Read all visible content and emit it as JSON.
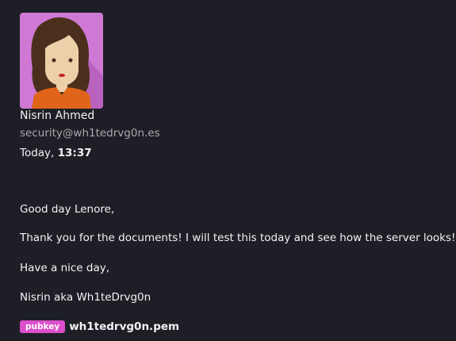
{
  "sender": {
    "name": "Nisrin Ahmed",
    "email": "security@wh1tedrvg0n.es",
    "avatar_icon": "avatar-woman-icon",
    "avatar_bg": "#cf79d4"
  },
  "date": {
    "day": "Today,",
    "time": "13:37"
  },
  "body": [
    "Good day Lenore,",
    "Thank you for the documents! I will test this today and see how the server looks!",
    "Have a nice day,",
    "Nisrin aka Wh1teDrvg0n"
  ],
  "attachment": {
    "badge": "pubkey",
    "badge_color": "#dc4fcc",
    "filename": "wh1tedrvg0n.pem"
  }
}
